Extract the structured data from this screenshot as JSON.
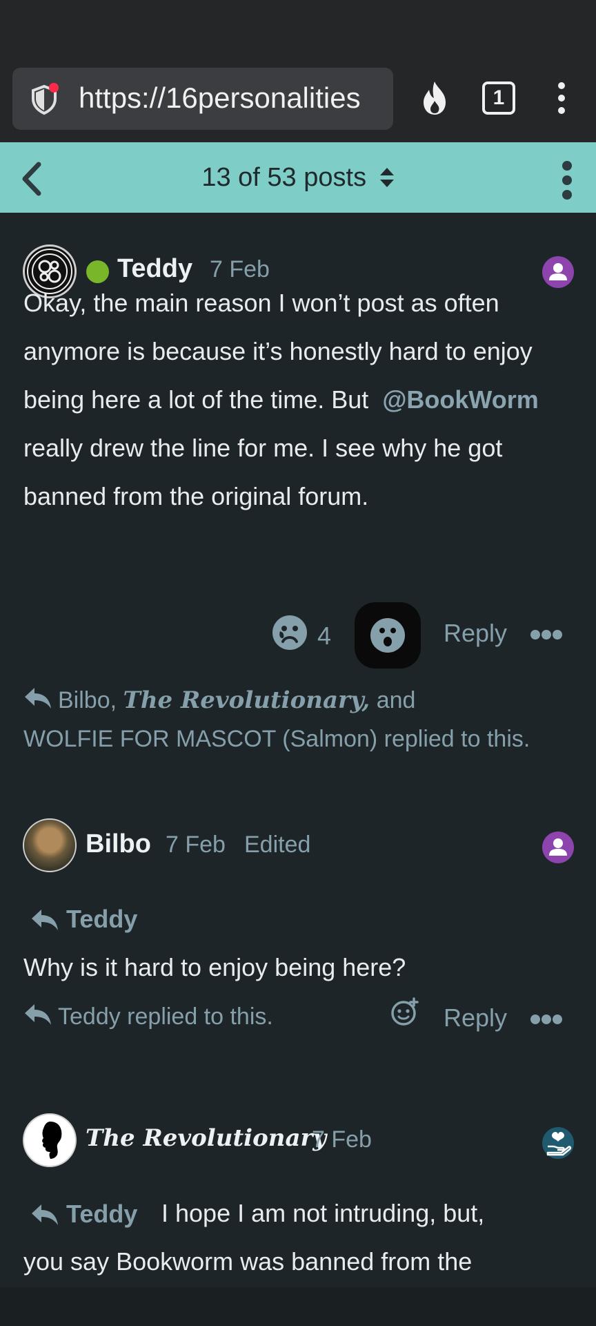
{
  "browser": {
    "url": "https://16personalities",
    "tab_count": "1",
    "icons": [
      "shield-icon",
      "fire-icon",
      "tab-count-icon",
      "kebab-menu-icon"
    ]
  },
  "topic_nav": {
    "position": "13 of 53 posts",
    "accent": "#7ecdc6"
  },
  "posts": [
    {
      "author": "Teddy",
      "date": "7 Feb",
      "online": true,
      "body_part1": "Okay, the main reason I won’t post as often anymore is because it’s honestly hard to enjoy being here a lot of the time. But",
      "mention": "@BookWorm",
      "body_part2": "really drew the line for me. I see why he got banned from the original forum.",
      "reaction_count": "4",
      "reply_label": "Reply",
      "replied_names_1": "Bilbo,",
      "replied_names_2": "The Revolutionary,",
      "replied_names_3": "and",
      "replied_line2": "WOLFIE FOR MASCOT (Salmon) replied to this."
    },
    {
      "author": "Bilbo",
      "date": "7 Feb",
      "edited": "Edited",
      "reply_to": "Teddy",
      "body": "Why is it hard to enjoy being here?",
      "replied_line": "Teddy replied to this.",
      "reply_label": "Reply"
    },
    {
      "author": "The Revolutionary",
      "date": "7 Feb",
      "reply_to": "Teddy",
      "body_part1": "I hope I am not intruding, but,",
      "body_part2": "you say Bookworm was banned from the"
    }
  ],
  "colors": {
    "background": "#1e2529",
    "muted": "#86a0ab",
    "online": "#79b62a",
    "profile": "#8e44ad"
  }
}
